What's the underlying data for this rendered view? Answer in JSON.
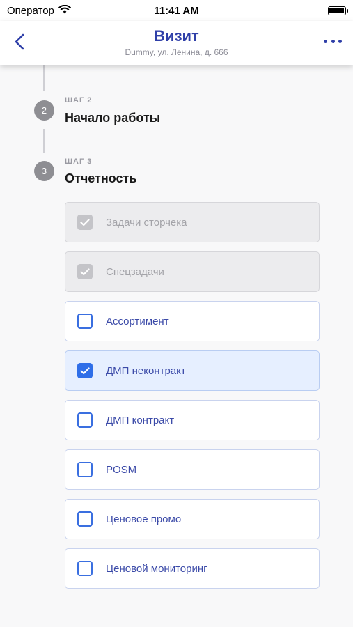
{
  "status_bar": {
    "carrier": "Оператор",
    "time": "11:41 AM"
  },
  "nav": {
    "title": "Визит",
    "subtitle": "Dummy, ул. Ленина, д. 666"
  },
  "steps": [
    {
      "number": "2",
      "label": "ШАГ 2",
      "title": "Начало работы"
    },
    {
      "number": "3",
      "label": "ШАГ 3",
      "title": "Отчетность"
    }
  ],
  "tasks": [
    {
      "label": "Задачи сторчека",
      "state": "disabled-checked"
    },
    {
      "label": "Спецзадачи",
      "state": "disabled-checked"
    },
    {
      "label": "Ассортимент",
      "state": "unchecked"
    },
    {
      "label": "ДМП неконтракт",
      "state": "checked"
    },
    {
      "label": "ДМП контракт",
      "state": "unchecked"
    },
    {
      "label": "POSM",
      "state": "unchecked"
    },
    {
      "label": "Ценовое промо",
      "state": "unchecked"
    },
    {
      "label": "Ценовой мониторинг",
      "state": "unchecked"
    }
  ],
  "colors": {
    "accent": "#2f3fa8",
    "checkbox_blue": "#2f6ee8",
    "step_circle": "#8e8e93"
  }
}
